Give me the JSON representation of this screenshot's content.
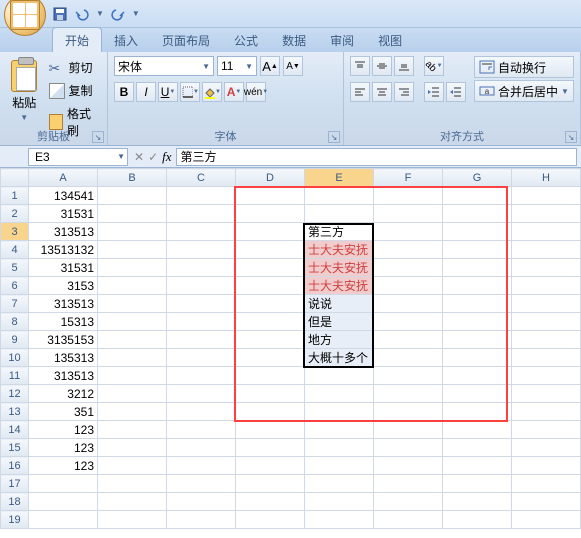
{
  "qat": {
    "save": "save",
    "undo": "undo",
    "redo": "redo"
  },
  "tabs": [
    "开始",
    "插入",
    "页面布局",
    "公式",
    "数据",
    "审阅",
    "视图"
  ],
  "active_tab": 0,
  "ribbon": {
    "clipboard": {
      "paste": "粘贴",
      "cut": "剪切",
      "copy": "复制",
      "format_painter": "格式刷",
      "label": "剪贴板"
    },
    "font": {
      "name": "宋体",
      "size": "11",
      "label": "字体",
      "grow": "A",
      "shrink": "A"
    },
    "align": {
      "wrap": "自动换行",
      "merge": "合并后居中",
      "label": "对齐方式"
    }
  },
  "namebox": "E3",
  "formula": "第三方",
  "columns": [
    "A",
    "B",
    "C",
    "D",
    "E",
    "F",
    "G",
    "H"
  ],
  "rows": [
    1,
    2,
    3,
    4,
    5,
    6,
    7,
    8,
    9,
    10,
    11,
    12,
    13,
    14,
    15,
    16,
    17,
    18,
    19
  ],
  "colA": [
    "134541",
    "31531",
    "313513",
    "13513132",
    "31531",
    "3153",
    "313513",
    "15313",
    "3135153",
    "135313",
    "313513",
    "3212",
    "351",
    "123",
    "123",
    "123"
  ],
  "colE": [
    {
      "v": "第三方",
      "cls": ""
    },
    {
      "v": "士大夫安抚",
      "cls": "red-txt"
    },
    {
      "v": "士大夫安抚",
      "cls": "red-txt"
    },
    {
      "v": "士大夫安抚",
      "cls": "red-txt"
    },
    {
      "v": "说说",
      "cls": ""
    },
    {
      "v": "但是",
      "cls": ""
    },
    {
      "v": "地方",
      "cls": ""
    },
    {
      "v": "大概十多个",
      "cls": ""
    }
  ],
  "active_cell": {
    "row": 3,
    "col": "E"
  },
  "chart_data": {
    "type": "table",
    "columns": [
      "A"
    ],
    "values": [
      134541,
      31531,
      313513,
      13513132,
      31531,
      3153,
      313513,
      15313,
      3135153,
      135313,
      313513,
      3212,
      351,
      123,
      123,
      123
    ]
  }
}
